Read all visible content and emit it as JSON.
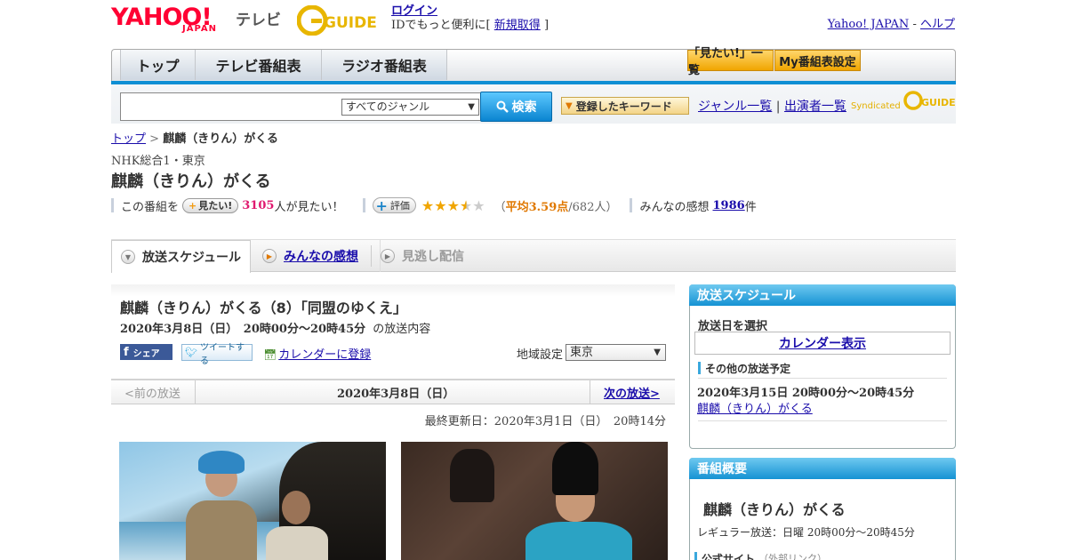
{
  "header": {
    "yahoo_logo": "YAHOO!",
    "japan_logo": "JAPAN",
    "tv_label": "テレビ",
    "gguide_logo": "G-GUIDE",
    "login_label": "ログイン",
    "id_text_prefix": "IDでもっと便利に[",
    "register_label": "新規取得",
    "id_text_suffix": "]",
    "yahoo_japan_link": "Yahoo! JAPAN",
    "help_link": "ヘルプ"
  },
  "nav": {
    "tabs": [
      {
        "label": "トップ"
      },
      {
        "label": "テレビ番組表"
      },
      {
        "label": "ラジオ番組表"
      }
    ],
    "mitai_list": "「見たい!」一覧",
    "my_bangumi": "My番組表設定"
  },
  "search": {
    "placeholder": "",
    "genre_selected": "すべてのジャンル",
    "search_button": "検索",
    "keyword_button": "登録したキーワード",
    "genre_list_link": "ジャンル一覧",
    "separator": "|",
    "performer_list_link": "出演者一覧",
    "syndicated": "Syndicated"
  },
  "breadcrumb": {
    "top": "トップ",
    "sep": ">",
    "current": "麒麟（きりん）がくる"
  },
  "program": {
    "channel": "NHK総合1・東京",
    "title": "麒麟（きりん）がくる",
    "kono_bangumi": "この番組を",
    "mitai_button": "見たい!",
    "mitai_count": "3105",
    "mitai_suffix": "人が見たい！",
    "hyoka_button": "評価",
    "rating_value": 3.59,
    "avg_prefix": "（",
    "avg_label": "平均3.59点",
    "avg_count": "/682人）",
    "kanso_label": "みんなの感想",
    "kanso_count": "1986",
    "kanso_suffix": "件"
  },
  "program_tabs": [
    {
      "label": "放送スケジュール"
    },
    {
      "label": "みんなの感想"
    },
    {
      "label": "見逃し配信"
    }
  ],
  "episode": {
    "title": "麒麟（きりん）がくる（8）「同盟のゆくえ」",
    "date": "2020年3月8日（日）　20時00分～20時45分",
    "date_suffix": "の放送内容",
    "facebook": "シェア",
    "twitter": "ツイートする",
    "calendar": "カレンダーに登録",
    "region_label": "地域設定",
    "region_value": "東京"
  },
  "datenav": {
    "prev": "<前の放送",
    "current": "2020年3月8日（日）",
    "next": "次の放送>"
  },
  "updated": "最終更新日：2020年3月1日（日）　20時14分",
  "side_schedule": {
    "title": "放送スケジュール",
    "select_day": "放送日を選択",
    "calendar_display": "カレンダー表示",
    "other_title": "その他の放送予定",
    "other_date": "2020年3月15日 20時00分～20時45分",
    "other_link": "麒麟（きりん）がくる"
  },
  "side_overview": {
    "title": "番組概要",
    "program_title": "麒麟（きりん）がくる",
    "regular": "レギュラー放送：日曜 20時00分～20時45分",
    "official_site": "公式サイト",
    "official_sub": "（外部リンク）"
  },
  "colors": {
    "accent_blue": "#0e8fd4",
    "yahoo_red": "#ff0033",
    "orange": "#f0a500",
    "pink": "#e0196f"
  }
}
